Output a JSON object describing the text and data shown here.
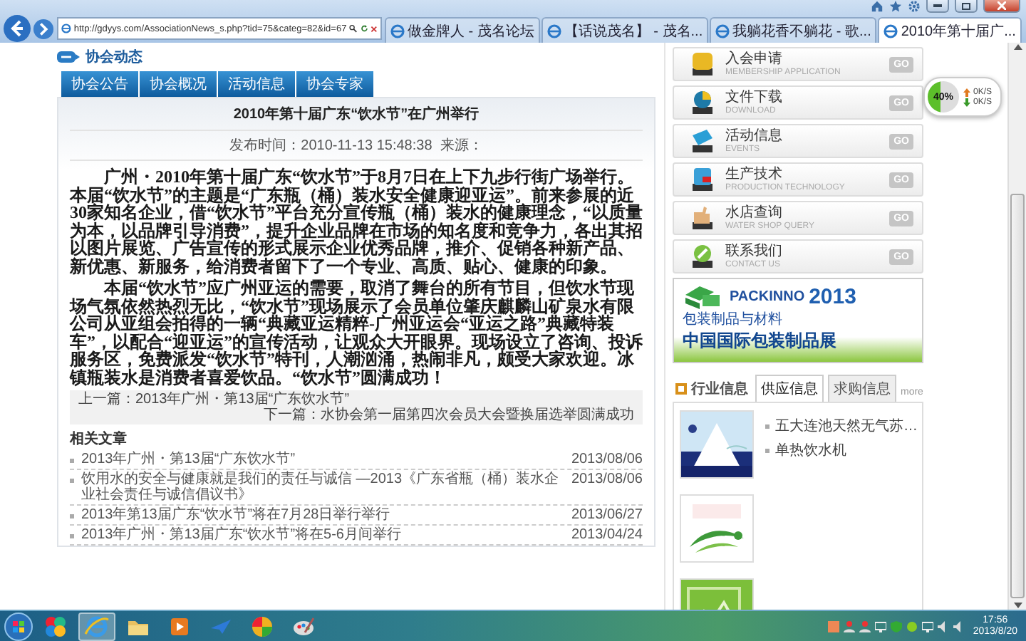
{
  "browser": {
    "address": "http://gdyys.com/AssociationNews_s.php?tid=75&categ=82&id=67",
    "tabs": [
      {
        "title": "做金牌人 - 茂名论坛",
        "selected": false
      },
      {
        "title": "【话说茂名】 - 茂名...",
        "selected": false
      },
      {
        "title": "我躺花香不躺花 - 歌...",
        "selected": false
      },
      {
        "title": "2010年第十届广...",
        "selected": true
      }
    ]
  },
  "section": {
    "title": "协会动态",
    "tabs": [
      "协会公告",
      "协会概况",
      "活动信息",
      "协会专家"
    ]
  },
  "article": {
    "title": "2010年第十届广东“饮水节”在广州举行",
    "meta": "发布时间：2010-11-13 15:48:38  来源：",
    "paragraphs": [
      "广州・2010年第十届广东“饮水节”于8月7日在上下九步行街广场举行。本届“饮水节”的主题是“广东瓶（桶）装水安全健康迎亚运”。前来参展的近30家知名企业，借“饮水节”平台充分宣传瓶（桶）装水的健康理念，“以质量为本，以品牌引导消费”，提升企业品牌在市场的知名度和竞争力，各出其招以图片展览、广告宣传的形式展示企业优秀品牌，推介、促销各种新产品、新优惠、新服务，给消费者留下了一个专业、高质、贴心、健康的印象。",
      "本届“饮水节”应广州亚运的需要，取消了舞台的所有节目，但饮水节现场气氛依然热烈无比，“饮水节”现场展示了会员单位肇庆麒麟山矿泉水有限公司从亚组会拍得的一辆“典藏亚运精粹-广州亚运会“亚运之路”典藏特装车”，以配合“迎亚运”的宣传活动，让观众大开眼界。现场设立了咨询、投诉服务区，免费派发“饮水节”特刊，人潮汹涌，热闹非凡，颇受大家欢迎。冰镇瓶装水是消费者喜爱饮品。“饮水节”圆满成功！"
    ],
    "prev": "上一篇：2013年广州・第13届“广东饮水节”",
    "next": "下一篇：水协会第一届第四次会员大会暨换届选举圆满成功"
  },
  "related": {
    "title": "相关文章",
    "items": [
      {
        "title": "2013年广州・第13届“广东饮水节”",
        "date": "2013/08/06"
      },
      {
        "title": "饮用水的安全与健康就是我们的责任与诚信 —2013《广东省瓶（桶）装水企业社会责任与诚信倡议书》",
        "date": "2013/08/06"
      },
      {
        "title": "2013年第13届广东“饮水节”将在7月28日举行举行",
        "date": "2013/06/27"
      },
      {
        "title": "2013年广州・第13届广东“饮水节”将在5-6月间举行",
        "date": "2013/04/24"
      }
    ]
  },
  "sidebar": {
    "menu": [
      {
        "kind": "member",
        "title": "入会申请",
        "subtitle": "MEMBERSHIP APPLICATION",
        "button": "GO"
      },
      {
        "kind": "download",
        "title": "文件下载",
        "subtitle": "DOWNLOAD",
        "button": "GO"
      },
      {
        "kind": "events",
        "title": "活动信息",
        "subtitle": "EVENTS",
        "button": "GO"
      },
      {
        "kind": "tech",
        "title": "生产技术",
        "subtitle": "PRODUCTION TECHNOLOGY",
        "button": "GO"
      },
      {
        "kind": "shop",
        "title": "水店查询",
        "subtitle": "WATER SHOP QUERY",
        "button": "GO"
      },
      {
        "kind": "contact",
        "title": "联系我们",
        "subtitle": "CONTACT US",
        "button": "GO"
      }
    ],
    "banner": {
      "brand": "PACKINNO",
      "year": "2013",
      "tagline": "包装制品与材料",
      "headline": "中国国际包装制品展"
    },
    "info": {
      "heading": "行业信息",
      "tabs": [
        {
          "label": "供应信息",
          "selected": true
        },
        {
          "label": "求购信息",
          "selected": false
        }
      ],
      "more": "more",
      "items": [
        "五大连池天然无气苏…",
        "单热饮水机"
      ],
      "thumbnails": [
        {
          "kind": "picture"
        },
        {
          "kind": "picture"
        },
        {
          "kind": "picture"
        }
      ]
    }
  },
  "speed_widget": {
    "level": 0.4,
    "percent": "40%",
    "upload": "0K/S",
    "download": "0K/S"
  },
  "taskbar": {
    "apps": [
      {
        "kind": "media",
        "active": false
      },
      {
        "kind": "ie",
        "active": true
      },
      {
        "kind": "folder",
        "active": false
      },
      {
        "kind": "player",
        "active": false
      },
      {
        "kind": "bird",
        "active": false
      },
      {
        "kind": "ball",
        "active": false
      },
      {
        "kind": "paint",
        "active": false
      }
    ],
    "time": "17:56",
    "date": "2013/8/20"
  }
}
